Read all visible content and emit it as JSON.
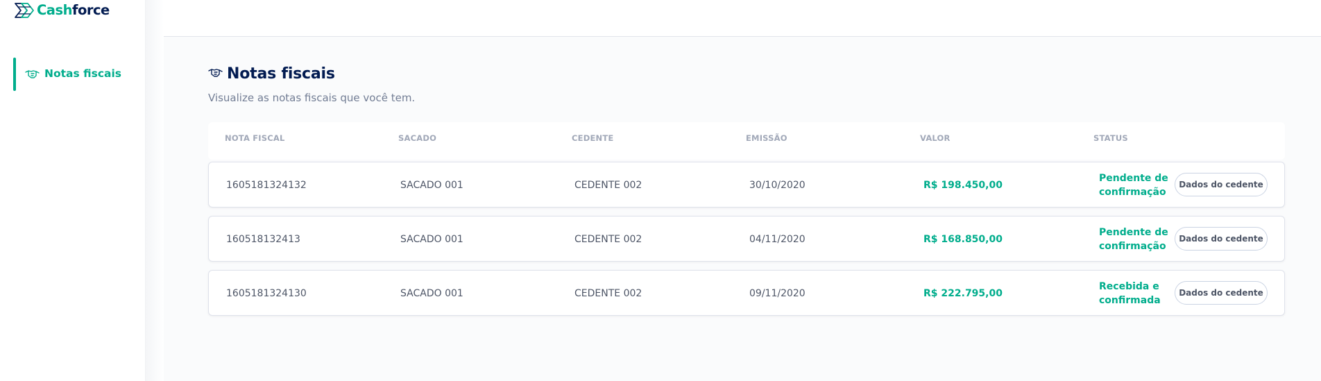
{
  "brand": {
    "name_part1": "Cash",
    "name_part2": "force",
    "accent": "#00ad8c",
    "navy": "#021b51",
    "icon": "cashforce-logo-icon"
  },
  "sidebar": {
    "items": [
      {
        "label": "Notas fiscais",
        "icon": "handshake-icon",
        "active": true
      }
    ]
  },
  "page": {
    "title": "Notas fiscais",
    "title_icon": "handshake-icon",
    "subtitle": "Visualize as notas fiscais que você tem."
  },
  "table": {
    "columns": [
      "NOTA FISCAL",
      "SACADO",
      "CEDENTE",
      "EMISSÃO",
      "VALOR",
      "STATUS"
    ],
    "rows": [
      {
        "nota": "1605181324132",
        "sacado": "SACADO 001",
        "cedente": "CEDENTE 002",
        "emissao": "30/10/2020",
        "valor": "R$ 198.450,00",
        "status_line1": "Pendente de",
        "status_line2": "confirmação",
        "action": "Dados do cedente"
      },
      {
        "nota": "160518132413",
        "sacado": "SACADO 001",
        "cedente": "CEDENTE 002",
        "emissao": "04/11/2020",
        "valor": "R$ 168.850,00",
        "status_line1": "Pendente de",
        "status_line2": "confirmação",
        "action": "Dados do cedente"
      },
      {
        "nota": "1605181324130",
        "sacado": "SACADO 001",
        "cedente": "CEDENTE 002",
        "emissao": "09/11/2020",
        "valor": "R$ 222.795,00",
        "status_line1": "Recebida e",
        "status_line2": "confirmada",
        "action": "Dados do cedente"
      }
    ]
  }
}
